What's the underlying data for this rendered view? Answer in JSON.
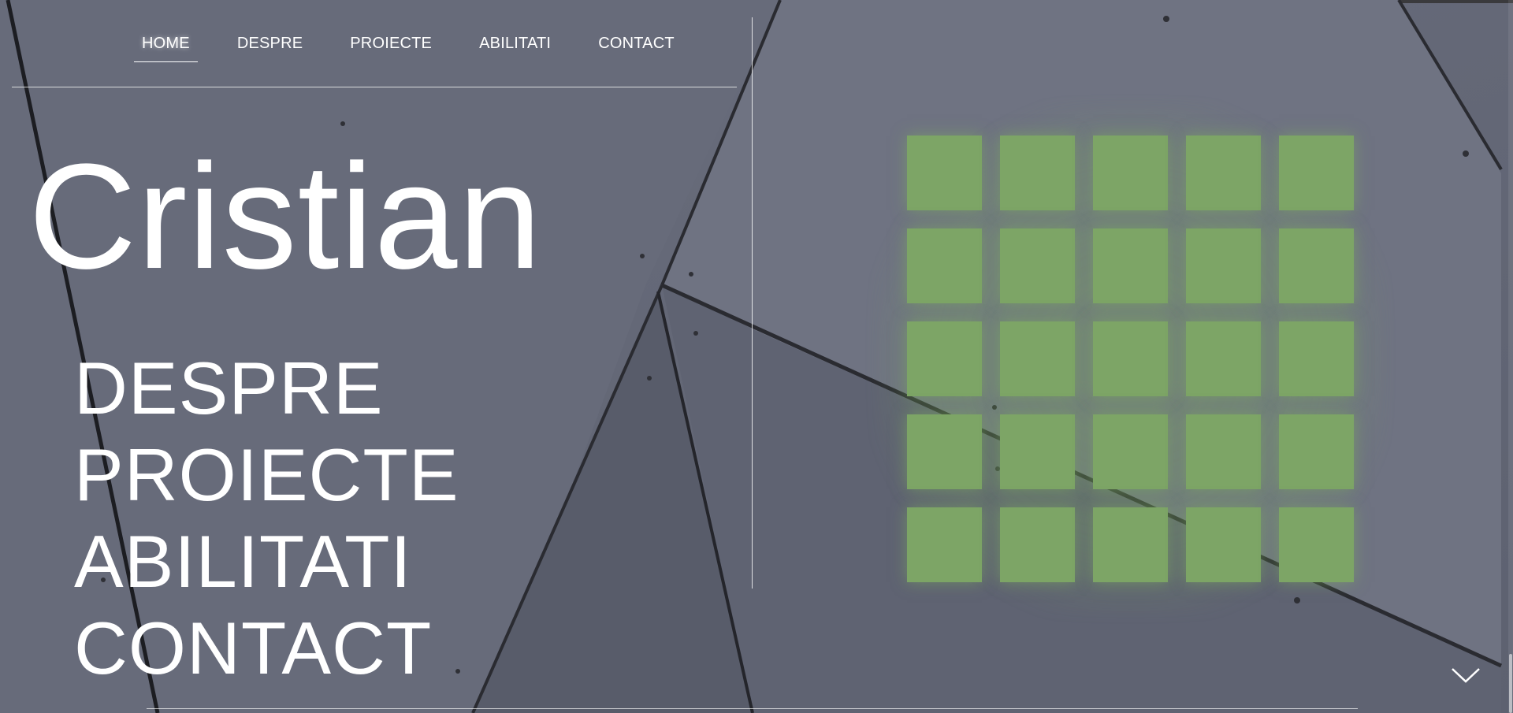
{
  "nav": {
    "items": [
      {
        "label": "HOME",
        "active": true
      },
      {
        "label": "DESPRE",
        "active": false
      },
      {
        "label": "PROIECTE",
        "active": false
      },
      {
        "label": "ABILITATI",
        "active": false
      },
      {
        "label": "CONTACT",
        "active": false
      }
    ]
  },
  "hero": {
    "name": "Cristian",
    "menu": [
      "DESPRE",
      "PROIECTE",
      "ABILITATI",
      "CONTACT"
    ]
  },
  "tiles": {
    "rows": 5,
    "cols": 5,
    "color": "#7da566"
  },
  "icons": {
    "scroll_down": "chevron-down-icon"
  },
  "colors": {
    "background": "#676b7a",
    "text": "#ffffff",
    "accent": "#7da566"
  }
}
